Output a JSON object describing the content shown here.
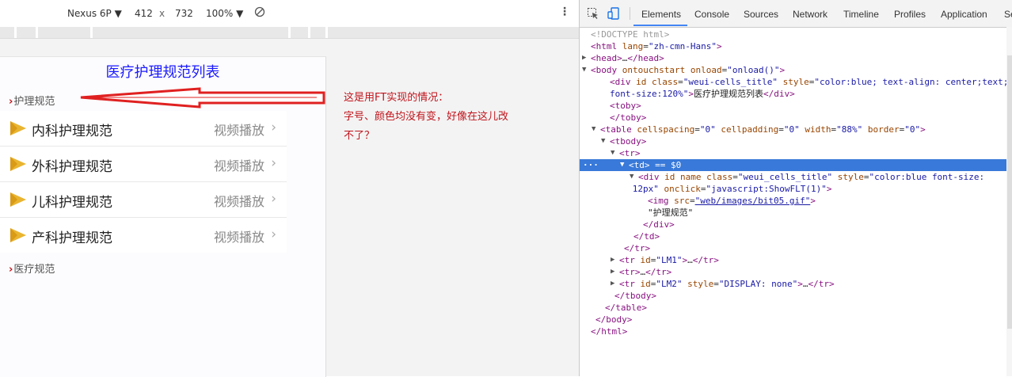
{
  "device_toolbar": {
    "device": "Nexus 6P ▼",
    "width": "412",
    "times": "x",
    "height": "732",
    "zoom": "100% ▼"
  },
  "phone": {
    "title": "医疗护理规范列表",
    "section1": "护理规范",
    "section2": "医疗规范",
    "rows": [
      {
        "label": "内科护理规范",
        "action": "视频播放"
      },
      {
        "label": "外科护理规范",
        "action": "视频播放"
      },
      {
        "label": "儿科护理规范",
        "action": "视频播放"
      },
      {
        "label": "产科护理规范",
        "action": "视频播放"
      }
    ],
    "caret": "›",
    "chevron": "›"
  },
  "annotation": {
    "line1": "这是用FT实现的情况：",
    "line2": "字号、颜色均没有变，好像在这儿改",
    "line3": "不了？"
  },
  "devtools": {
    "tabs": [
      "Elements",
      "Console",
      "Sources",
      "Network",
      "Timeline",
      "Profiles",
      "Application",
      "Se"
    ],
    "active_tab": "Elements",
    "selected_suffix": " == $0",
    "lines": [
      {
        "i": 0,
        "t": "",
        "html": "<span class='cm'>&lt;!DOCTYPE html&gt;</span>"
      },
      {
        "i": 0,
        "t": "",
        "html": "<span class='tag'>&lt;html</span> <span class='an'>lang</span>=<span class='av'>\"zh-cmn-Hans\"</span><span class='tag'>&gt;</span>"
      },
      {
        "i": 0,
        "t": "▶",
        "html": "<span class='tag'>&lt;head&gt;</span>…<span class='tag'>&lt;/head&gt;</span>"
      },
      {
        "i": 0,
        "t": "▼",
        "html": "<span class='tag'>&lt;body</span> <span class='an'>ontouchstart</span> <span class='an'>onload</span>=<span class='av'>\"onload()\"</span><span class='tag'>&gt;</span>"
      },
      {
        "i": 2,
        "t": "",
        "html": "<span class='tag'>&lt;div</span> <span class='an'>id</span> <span class='an'>class</span>=<span class='av'>\"weui-cells_title\"</span> <span class='an'>style</span>=<span class='av'>\"color:blue; text-align: center;text;</span>"
      },
      {
        "i": 2,
        "t": "",
        "html": "<span class='av'>font-size:120%\"</span><span class='tag'>&gt;</span><span class='tc'>医疗护理规范列表</span><span class='tag'>&lt;/div&gt;</span>"
      },
      {
        "i": 2,
        "t": "",
        "html": "<span class='tag'>&lt;toby&gt;</span>"
      },
      {
        "i": 2,
        "t": "",
        "html": "<span class='tag'>&lt;/toby&gt;</span>"
      },
      {
        "i": 1,
        "t": "▼",
        "html": "<span class='tag'>&lt;table</span> <span class='an'>cellspacing</span>=<span class='av'>\"0\"</span> <span class='an'>cellpadding</span>=<span class='av'>\"0\"</span> <span class='an'>width</span>=<span class='av'>\"88%\"</span> <span class='an'>border</span>=<span class='av'>\"0\"</span><span class='tag'>&gt;</span>"
      },
      {
        "i": 2,
        "t": "▼",
        "html": "<span class='tag'>&lt;tbody&gt;</span>"
      },
      {
        "i": 3,
        "t": "▼",
        "html": "<span class='tag'>&lt;tr&gt;</span>"
      },
      {
        "i": 4,
        "t": "▼",
        "html": "<span class='tag'>&lt;td&gt;</span>",
        "sel": true
      },
      {
        "i": 5,
        "t": "▼",
        "html": "<span class='tag'>&lt;div</span> <span class='an'>id</span> <span class='an'>name</span> <span class='an'>class</span>=<span class='av'>\"weui_cells_title\"</span> <span class='an'>style</span>=<span class='av'>\"color:blue font-size:</span>"
      },
      {
        "i": 4.4,
        "t": "",
        "html": "<span class='av'>12px\"</span> <span class='an'>onclick</span>=<span class='av'>\"javascript:ShowFLT(1)\"</span><span class='tag'>&gt;</span>"
      },
      {
        "i": 6,
        "t": "",
        "html": "<span class='tag'>&lt;img</span> <span class='an'>src</span>=<span class='lk'>\"web/images/bit05.gif\"</span><span class='tag'>&gt;</span>"
      },
      {
        "i": 6,
        "t": "",
        "html": "<span class='tc'>\"护理规范\"</span>"
      },
      {
        "i": 5.5,
        "t": "",
        "html": "<span class='tag'>&lt;/div&gt;</span>"
      },
      {
        "i": 4.5,
        "t": "",
        "html": "<span class='tag'>&lt;/td&gt;</span>"
      },
      {
        "i": 3.5,
        "t": "",
        "html": "<span class='tag'>&lt;/tr&gt;</span>"
      },
      {
        "i": 3,
        "t": "▶",
        "html": "<span class='tag'>&lt;tr</span> <span class='an'>id</span>=<span class='av'>\"LM1\"</span><span class='tag'>&gt;</span>…<span class='tag'>&lt;/tr&gt;</span>"
      },
      {
        "i": 3,
        "t": "▶",
        "html": "<span class='tag'>&lt;tr&gt;</span>…<span class='tag'>&lt;/tr&gt;</span>"
      },
      {
        "i": 3,
        "t": "▶",
        "html": "<span class='tag'>&lt;tr</span> <span class='an'>id</span>=<span class='av'>\"LM2\"</span> <span class='an'>style</span>=<span class='av'>\"DISPLAY: none\"</span><span class='tag'>&gt;</span>…<span class='tag'>&lt;/tr&gt;</span>"
      },
      {
        "i": 2.5,
        "t": "",
        "html": "<span class='tag'>&lt;/tbody&gt;</span>"
      },
      {
        "i": 1.5,
        "t": "",
        "html": "<span class='tag'>&lt;/table&gt;</span>"
      },
      {
        "i": 0.5,
        "t": "",
        "html": "<span class='tag'>&lt;/body&gt;</span>"
      },
      {
        "i": 0,
        "t": "",
        "html": "<span class='tag'>&lt;/html&gt;</span>"
      }
    ]
  }
}
